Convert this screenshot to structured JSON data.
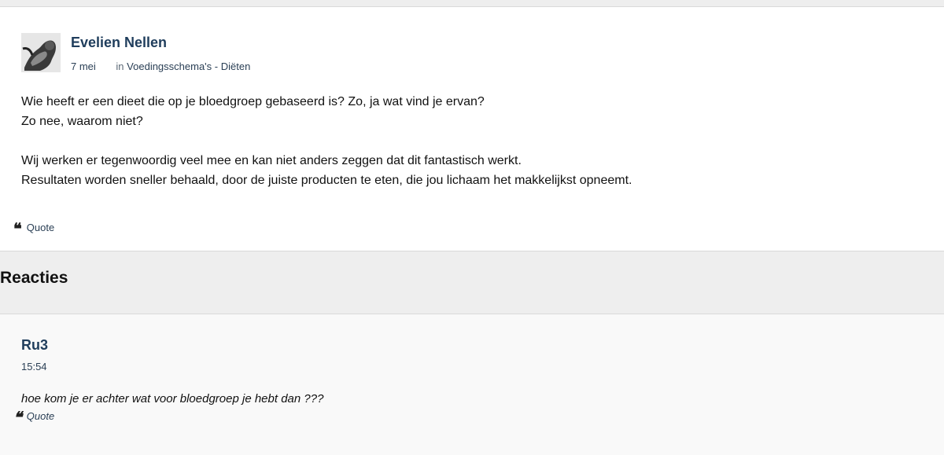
{
  "post": {
    "author": "Evelien Nellen",
    "date": "7 mei",
    "in_label": "in",
    "category": "Voedingsschema's - Diëten",
    "lines_para1": [
      "Wie heeft er een dieet die op je bloedgroep gebaseerd is? Zo, ja wat vind je ervan?",
      "Zo nee, waarom niet?"
    ],
    "lines_para2": [
      "Wij werken er tegenwoordig veel mee en kan niet anders zeggen dat dit fantastisch werkt.",
      "Resultaten worden sneller behaald, door de juiste producten te eten, die jou lichaam het makkelijkst opneemt."
    ],
    "quote_label": "Quote",
    "quote_icon": "quote-icon"
  },
  "reacties": {
    "title": "Reacties"
  },
  "comments": [
    {
      "author": "Ru3",
      "time": "15:54",
      "text": "hoe kom je er achter wat voor bloedgroep je hebt dan ???",
      "quote_label": "Quote",
      "quote_icon": "quote-icon"
    }
  ],
  "colors": {
    "link": "#1f3d5c",
    "page_bg": "#eeeeee",
    "card_bg": "#ffffff"
  }
}
